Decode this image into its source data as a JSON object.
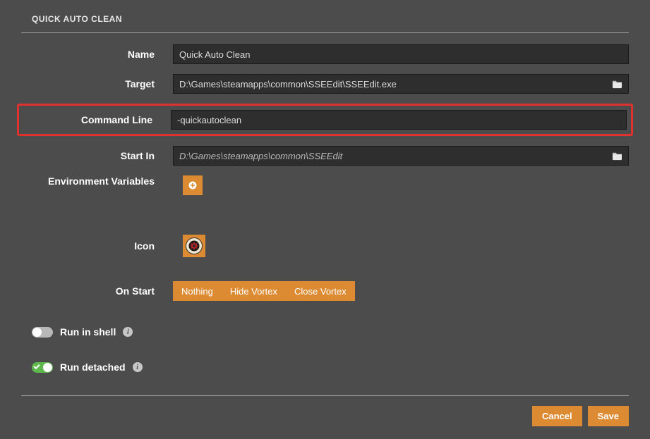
{
  "title": "QUICK AUTO CLEAN",
  "labels": {
    "name": "Name",
    "target": "Target",
    "command_line": "Command Line",
    "start_in": "Start In",
    "env_vars": "Environment Variables",
    "icon": "Icon",
    "on_start": "On Start"
  },
  "values": {
    "name": "Quick Auto Clean",
    "target": "D:\\Games\\steamapps\\common\\SSEEdit\\SSEEdit.exe",
    "command_line": "-quickautoclean",
    "start_in": "D:\\Games\\steamapps\\common\\SSEEdit"
  },
  "on_start_options": [
    "Nothing",
    "Hide Vortex",
    "Close Vortex"
  ],
  "switches": {
    "run_in_shell": {
      "label": "Run in shell",
      "on": false
    },
    "run_detached": {
      "label": "Run detached",
      "on": true
    }
  },
  "footer": {
    "cancel": "Cancel",
    "save": "Save"
  },
  "colors": {
    "accent": "#dd8b32",
    "highlight": "#e03131",
    "switch_on": "#5fb84e"
  }
}
